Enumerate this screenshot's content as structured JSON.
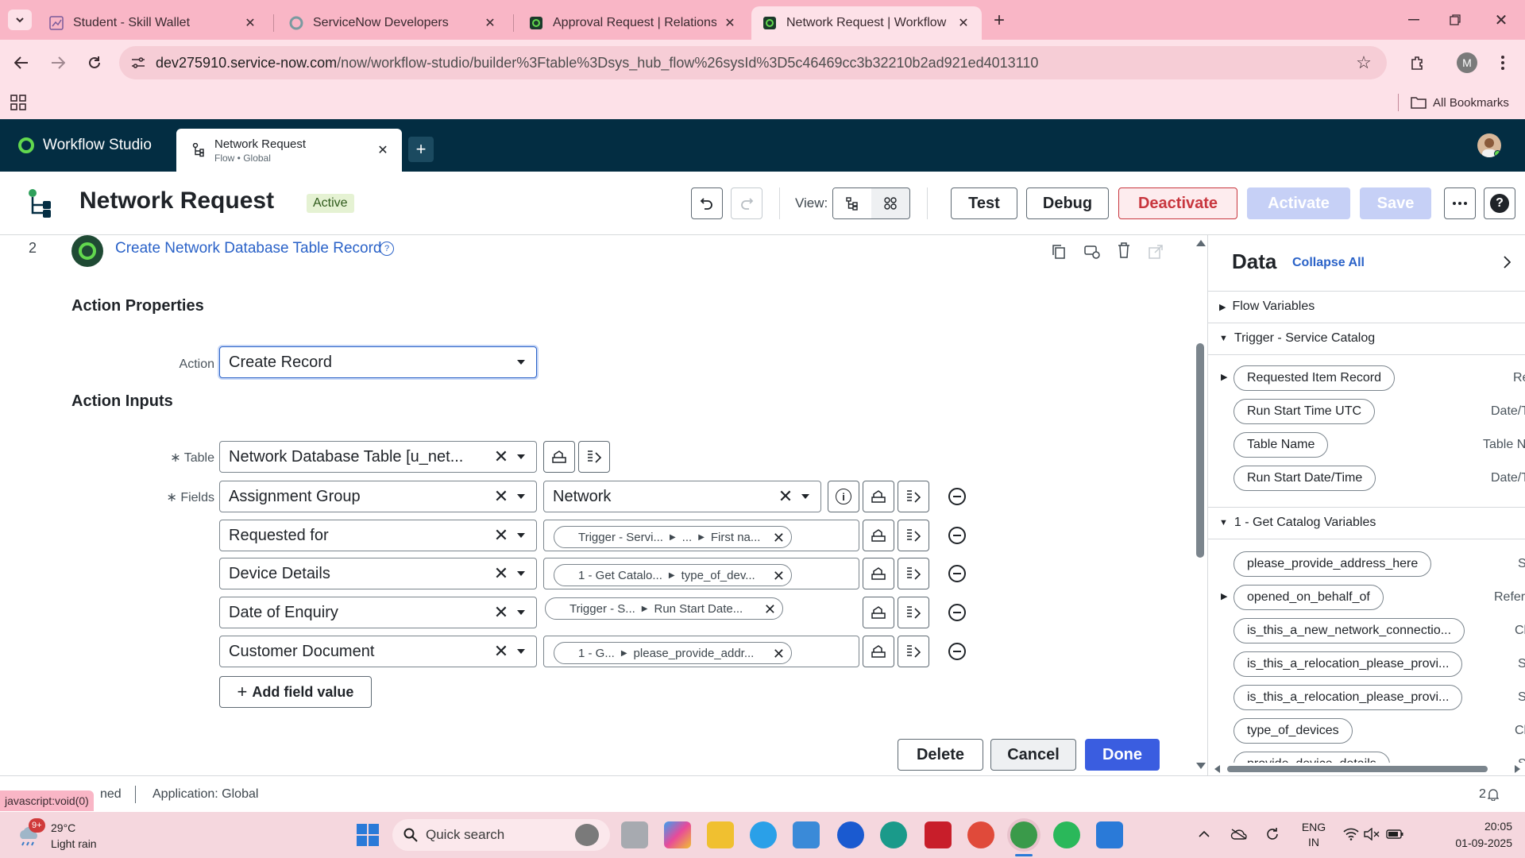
{
  "browser": {
    "tabs": [
      {
        "label": "Student - Skill Wallet"
      },
      {
        "label": "ServiceNow Developers"
      },
      {
        "label": "Approval Request | Relationship"
      },
      {
        "label": "Network Request | Workflow Stu"
      }
    ],
    "url_host": "dev275910.service-now.com",
    "url_path": "/now/workflow-studio/builder%3Ftable%3Dsys_hub_flow%26sysId%3D5c46469cc3b32210b2ad921ed4013110",
    "profile_initial": "M",
    "bookmarks_label": "All Bookmarks"
  },
  "app": {
    "name": "Workflow Studio",
    "tab_title": "Network Request",
    "tab_subtitle": "Flow • Global"
  },
  "flow": {
    "title": "Network Request",
    "status": "Active",
    "view_label": "View:",
    "buttons": {
      "test": "Test",
      "debug": "Debug",
      "deactivate": "Deactivate",
      "activate": "Activate",
      "save": "Save"
    }
  },
  "step": {
    "number": "2",
    "title": "Create Network Database Table Record"
  },
  "action_properties": {
    "heading": "Action Properties",
    "action_label": "Action",
    "action_value": "Create Record"
  },
  "action_inputs": {
    "heading": "Action Inputs",
    "table_label": "Table",
    "table_value": "Network Database Table [u_net...",
    "fields_label": "Fields",
    "fields": [
      {
        "name": "Assignment Group",
        "value": "Network"
      },
      {
        "name": "Requested for",
        "pill": [
          "Trigger - Servi...",
          "...",
          "First na..."
        ]
      },
      {
        "name": "Device Details",
        "pill": [
          "1 - Get Catalo...",
          "type_of_dev..."
        ]
      },
      {
        "name": "Date of Enquiry",
        "pill": [
          "Trigger - S...",
          "Run Start Date..."
        ]
      },
      {
        "name": "Customer Document",
        "pill": [
          "1 - G...",
          "please_provide_addr..."
        ]
      }
    ],
    "add_field_label": "Add field value"
  },
  "footer_buttons": {
    "delete": "Delete",
    "cancel": "Cancel",
    "done": "Done"
  },
  "data_panel": {
    "title": "Data",
    "collapse_all": "Collapse All",
    "sections": {
      "flow_variables": "Flow Variables",
      "trigger": "Trigger - Service Catalog",
      "catalog": "1 - Get Catalog Variables"
    },
    "trigger_items": [
      {
        "label": "Requested Item Record",
        "type": "Re"
      },
      {
        "label": "Run Start Time UTC",
        "type": "Date/T"
      },
      {
        "label": "Table Name",
        "type": "Table N"
      },
      {
        "label": "Run Start Date/Time",
        "type": "Date/T"
      }
    ],
    "catalog_items": [
      {
        "label": "please_provide_address_here",
        "type": "St"
      },
      {
        "label": "opened_on_behalf_of",
        "type": "Refere"
      },
      {
        "label": "is_this_a_new_network_connectio...",
        "type": "Ch"
      },
      {
        "label": "is_this_a_relocation_please_provi...",
        "type": "St"
      },
      {
        "label": "is_this_a_relocation_please_provi...",
        "type": "St"
      },
      {
        "label": "type_of_devices",
        "type": "Ch"
      },
      {
        "label": "provide_device_details",
        "type": "St"
      }
    ]
  },
  "status_bar": {
    "hover_link": "javascript:void(0)",
    "partial_text": "ned",
    "application": "Application: Global",
    "count": "2"
  },
  "taskbar": {
    "weather_temp": "29°C",
    "weather_desc": "Light rain",
    "weather_badge": "9+",
    "search_placeholder": "Quick search",
    "lang_top": "ENG",
    "lang_bottom": "IN",
    "time": "20:05",
    "date": "01-09-2025"
  }
}
